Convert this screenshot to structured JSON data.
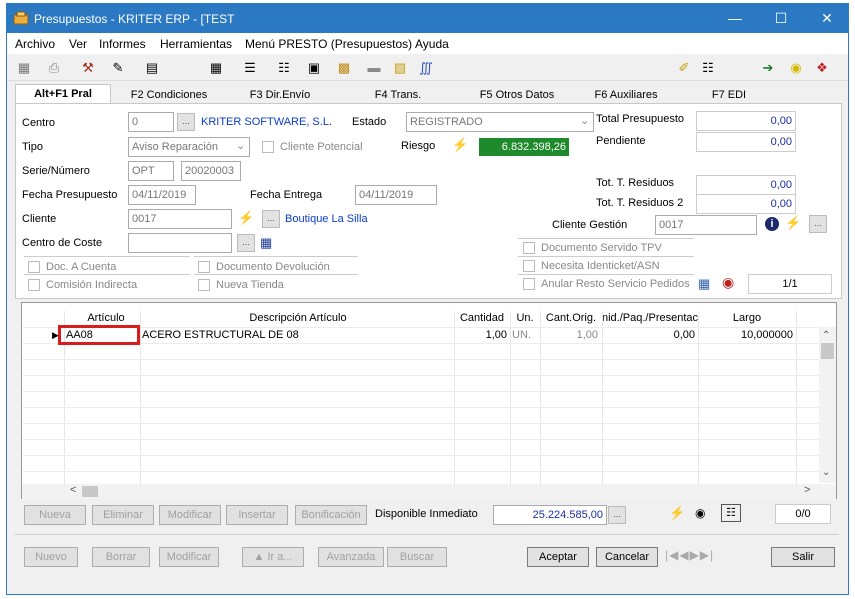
{
  "window": {
    "title": "Presupuestos - KRITER ERP - [TEST"
  },
  "menu": [
    "Archivo",
    "Ver",
    "Informes",
    "Herramientas",
    "Menú PRESTO (Presupuestos)",
    "Ayuda"
  ],
  "tabs": [
    "Alt+F1 Pral",
    "F2 Condiciones",
    "F3 Dir.Envío",
    "F4 Trans.",
    "F5 Otros Datos",
    "F6 Auxiliares",
    "F7 EDI"
  ],
  "form": {
    "centro_label": "Centro",
    "centro_value": "0",
    "empresa_name": "KRITER SOFTWARE, S.L.",
    "estado_label": "Estado",
    "estado_value": "REGISTRADO",
    "tipo_label": "Tipo",
    "tipo_value": "Aviso Reparación",
    "cliente_potencial_label": "Cliente Potencial",
    "riesgo_label": "Riesgo",
    "riesgo_value": "6.832.398,26",
    "serie_label": "Serie/Número",
    "serie_value": "OPT",
    "numero_value": "20020003",
    "fecha_presupuesto_label": "Fecha Presupuesto",
    "fecha_presupuesto_value": "04/11/2019",
    "fecha_entrega_label": "Fecha Entrega",
    "fecha_entrega_value": "04/11/2019",
    "cliente_label": "Cliente",
    "cliente_value": "0017",
    "cliente_name": "Boutique La Silla",
    "centro_coste_label": "Centro de Coste",
    "centro_coste_value": "",
    "total_presupuesto_label": "Total Presupuesto",
    "total_presupuesto_value": "0,00",
    "pendiente_label": "Pendiente",
    "pendiente_value": "0,00",
    "tot_residuos_label": "Tot. T. Residuos",
    "tot_residuos_value": "0,00",
    "tot_residuos2_label": "Tot. T. Residuos 2",
    "tot_residuos2_value": "0,00",
    "cliente_gestion_label": "Cliente Gestión",
    "cliente_gestion_value": "0017",
    "doc_a_cuenta_label": "Doc. A Cuenta",
    "comision_indirecta_label": "Comisión Indirecta",
    "documento_devolucion_label": "Documento Devolución",
    "nueva_tienda_label": "Nueva Tienda",
    "documento_servido_tpv_label": "Documento Servido TPV",
    "necesita_identicket_label": "Necesita Identicket/ASN",
    "anular_resto_label": "Anular Resto Servicio Pedidos",
    "pager_value": "1/1"
  },
  "grid": {
    "columns": [
      "Artículo",
      "Descripción Artículo",
      "Cantidad",
      "Un.",
      "Cant.Orig.",
      "nid./Paq./Presentaci",
      "Largo"
    ],
    "rows": [
      {
        "articulo": "AA08",
        "descripcion": "ACERO ESTRUCTURAL DE 08",
        "cantidad": "1,00",
        "un": "UN.",
        "cant_orig": "1,00",
        "unid_paq": "0,00",
        "largo": "10,000000"
      }
    ]
  },
  "line_buttons": [
    "Nueva",
    "Eliminar",
    "Modificar",
    "Insertar",
    "Bonificación"
  ],
  "disponible": {
    "label": "Disponible Inmediato",
    "value": "25.224.585,00"
  },
  "line_pager": "0/0",
  "bottom_buttons": [
    "Nuevo",
    "Borrar",
    "Modificar",
    "Ir a...",
    "Avanzada",
    "Buscar",
    "Aceptar",
    "Cancelar",
    "Salir"
  ],
  "colors": {
    "titlebar": "#2b78c3",
    "riesgo_bg": "#1f8a2b",
    "highlight": "#d71e1e",
    "link": "#0a3cc8"
  },
  "icons": {
    "toolbar": [
      "preview-icon",
      "print-icon",
      "tools-icon",
      "edit-icon",
      "copy-icon",
      "calculator-icon",
      "tree-icon",
      "list-icon",
      "note-icon",
      "import-icon",
      "tag-icon",
      "folder-icon",
      "clip-icon",
      "attachment-icon",
      "schema-icon",
      "export-icon",
      "lightbulb-icon",
      "help-icon"
    ]
  }
}
